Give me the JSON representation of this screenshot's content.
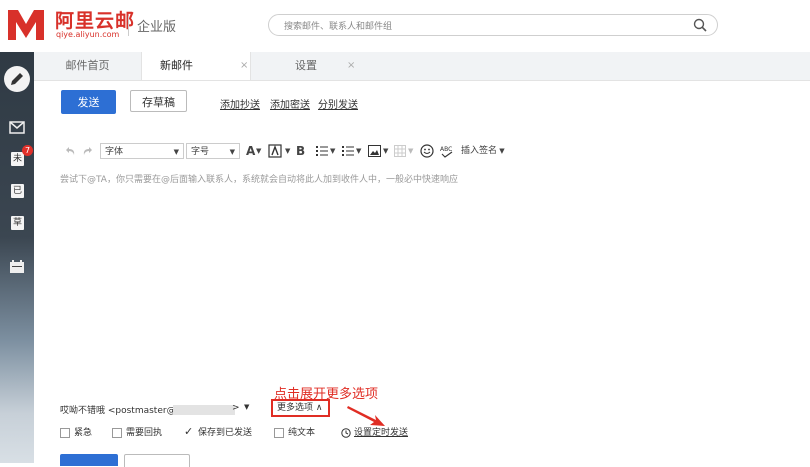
{
  "brand": {
    "name_cn": "阿里云邮",
    "domain": "qiye.aliyun.com",
    "edition": "企业版"
  },
  "search": {
    "placeholder": "搜索邮件、联系人和邮件组"
  },
  "sidebar": {
    "badge_count": "7",
    "items": [
      {
        "label": "未"
      },
      {
        "label": "已"
      },
      {
        "label": "草"
      }
    ]
  },
  "tabs": [
    {
      "label": "邮件首页"
    },
    {
      "label": "新邮件"
    },
    {
      "label": "设置"
    }
  ],
  "tab_close_symbol": "×",
  "toolbar": {
    "send_label": "发送",
    "draft_label": "存草稿",
    "add_cc": "添加抄送",
    "add_bcc": "添加密送",
    "separate_send": "分别发送"
  },
  "editor": {
    "font_label": "字体",
    "size_label": "字号",
    "bold_label": "B",
    "letter_a": "A",
    "insert_signature": "插入签名",
    "hint": "尝试下@TA，你只需要在@后面输入联系人，系统就会自动将此人加到收件人中，一般必中快速响应"
  },
  "from": {
    "label": "哎呦不错哦 <postmaster@",
    "suffix": ">"
  },
  "more_options": {
    "label": "更多选项 ∧"
  },
  "annotation": {
    "text": "点击展开更多选项"
  },
  "options": [
    {
      "label": "紧急",
      "checked": false
    },
    {
      "label": "需要回执",
      "checked": false
    },
    {
      "label": "保存到已发送",
      "checked": true
    },
    {
      "label": "纯文本",
      "checked": false
    }
  ],
  "schedule_label": "设置定时发送",
  "colors": {
    "brand_red": "#d8312a",
    "primary_blue": "#2d6fd4",
    "annotation_red": "#e02d24"
  }
}
